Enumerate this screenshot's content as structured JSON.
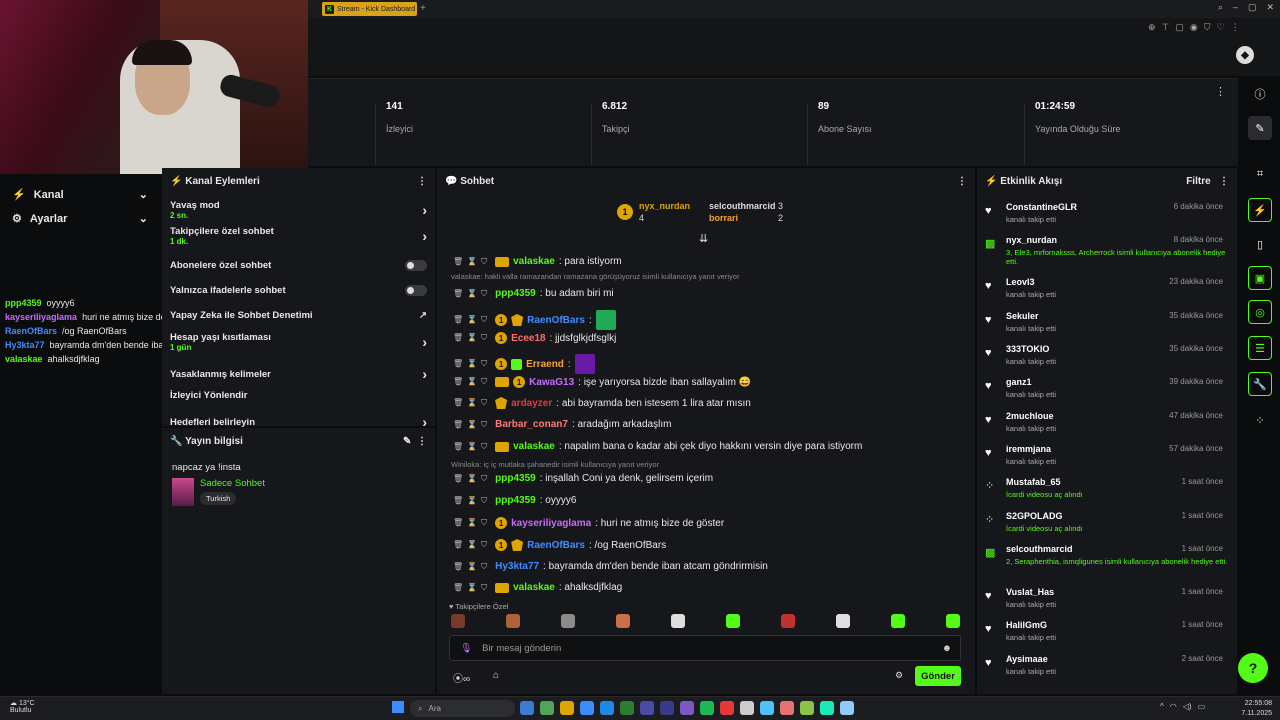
{
  "browser": {
    "tab_title": "Stream - Kick Dashboard",
    "tab_icon_letter": "K"
  },
  "sidebar": {
    "items": [
      {
        "label": "Kanal",
        "icon": "bolt-icon"
      },
      {
        "label": "Ayarlar",
        "icon": "gear-icon"
      }
    ]
  },
  "overlay_chat": [
    {
      "user": "ppp4359",
      "text": "oyyyy6",
      "color": "#53fc18"
    },
    {
      "user": "kayseriliyaglama",
      "text": "huri ne atmış bize de göster",
      "color": "#c86bff"
    },
    {
      "user": "RaenOfBars",
      "text": "/og RaenOfBars",
      "color": "#3f8cff"
    },
    {
      "user": "Hy3kta77",
      "text": "bayramda dm'den bende iban atcam göndrirmisin",
      "color": "#3f8cff"
    },
    {
      "user": "valaskae",
      "text": "ahalksdjfklag",
      "color": "#53fc18"
    }
  ],
  "stats": [
    {
      "value": "141",
      "label": "İzleyici"
    },
    {
      "value": "6.812",
      "label": "Takipçi"
    },
    {
      "value": "89",
      "label": "Abone Sayısı"
    },
    {
      "value": "01:24:59",
      "label": "Yayında Olduğu Süre"
    }
  ],
  "kanal_eylemleri": {
    "title": "Kanal Eylemleri",
    "rows": [
      {
        "label": "Yavaş mod",
        "sub": "2 sn.",
        "control": "chevron"
      },
      {
        "label": "Takipçilere özel sohbet",
        "sub": "1 dk.",
        "control": "chevron"
      },
      {
        "label": "Abonelere özel sohbet",
        "sub": "",
        "control": "toggle"
      },
      {
        "label": "Yalnızca ifadelerle sohbet",
        "sub": "",
        "control": "toggle"
      },
      {
        "label": "Yapay Zeka ile Sohbet Denetimi",
        "sub": "",
        "control": "external"
      },
      {
        "label": "Hesap yaşı kısıtlaması",
        "sub": "1 gün",
        "control": "chevron"
      },
      {
        "label": "Yasaklanmış kelimeler",
        "sub": "",
        "control": "chevron"
      },
      {
        "label": "İzleyici Yönlendir",
        "sub": "",
        "control": "none"
      },
      {
        "label": "Hedefleri belirleyin",
        "sub": "",
        "control": "chevron"
      }
    ]
  },
  "yayin_bilgisi": {
    "title": "Yayın bilgisi",
    "stream_title": "napcaz ya !insta",
    "category": "Sadece Sohbet",
    "tag": "Turkish"
  },
  "chat": {
    "title": "Sohbet",
    "pinned": [
      {
        "user": "nyx_nurdan",
        "count": "4"
      },
      {
        "user": "selcouthmarcid",
        "count": "3"
      },
      {
        "user": "borrari",
        "count": "2"
      }
    ],
    "messages": [
      {
        "user": "valaskae",
        "text": ": para istiyorm",
        "color": "#53fc18",
        "badges": [
          "crown"
        ]
      },
      {
        "reply": "valaskae: hakli valla ramazandan ramazana görüşüyoruz isimli kullanıcıya yanıt veriyor"
      },
      {
        "user": "ppp4359",
        "text": ": bu adam biri mi",
        "color": "#53fc18",
        "badges": []
      },
      {
        "user": "RaenOfBars",
        "text": ":",
        "color": "#3f8cff",
        "badges": [
          "one",
          "shield"
        ],
        "emote": "#1faa55"
      },
      {
        "user": "Ecee18",
        "text": ": jjdsfglkjdfsglkj",
        "color": "#ff6b6b",
        "badges": [
          "one"
        ]
      },
      {
        "user": "Erraend",
        "text": ":",
        "color": "#f7a23a",
        "badges": [
          "one",
          "gift"
        ],
        "emote": "#6a1aa8"
      },
      {
        "user": "KawaG13",
        "text": ": işe yarıyorsa bizde iban sallayalım 😄",
        "color": "#c86bff",
        "badges": [
          "crown",
          "one"
        ]
      },
      {
        "user": "ardayzer",
        "text": ": abi bayramda ben istesem 1 lira atar mısın",
        "color": "#e03b3b",
        "badges": [
          "shield"
        ]
      },
      {
        "user": "Barbar_conan7",
        "text": ": aradağım arkadaşlım",
        "color": "#ff7a7a",
        "badges": []
      },
      {
        "user": "valaskae",
        "text": ": napalım bana o kadar abi çek diyo hakkını versin diye para istiyorm",
        "color": "#53fc18",
        "badges": [
          "crown"
        ]
      },
      {
        "reply": "Winiloka: iç iç mutlaka şahanedir isimli kullanıcıya yanıt veriyor"
      },
      {
        "user": "ppp4359",
        "text": ": inşallah Coni ya denk, gelirsem içerim",
        "color": "#53fc18",
        "badges": []
      },
      {
        "user": "ppp4359",
        "text": ": oyyyy6",
        "color": "#53fc18",
        "badges": []
      },
      {
        "user": "kayseriliyaglama",
        "text": ": huri ne atmış bize de göster",
        "color": "#c86bff",
        "badges": [
          "one"
        ]
      },
      {
        "user": "RaenOfBars",
        "text": ": /og RaenOfBars",
        "color": "#3f8cff",
        "badges": [
          "one",
          "shield"
        ]
      },
      {
        "user": "Hy3kta77",
        "text": ": bayramda dm'den bende iban atcam göndrirmisin",
        "color": "#3f8cff",
        "badges": []
      },
      {
        "user": "valaskae",
        "text": ": ahalksdjfklag",
        "color": "#53fc18",
        "badges": [
          "crown"
        ]
      }
    ],
    "emote_label": "Takipçilere Özel",
    "input_placeholder": "Bir mesaj gönderin",
    "send_label": "Gönder"
  },
  "events": {
    "title": "Etkinlik Akışı",
    "filter_label": "Filtre",
    "items": [
      {
        "name": "ConstantineGLR",
        "desc": "kanalı takip etti",
        "time": "6 dakika önce",
        "icon": "heart"
      },
      {
        "name": "nyx_nurdan",
        "desc": "3, Efe3, mrfornaksss, Archerrock isimli kullanıcıya abonelik hediye etti.",
        "time": "8 dakika önce",
        "icon": "gift"
      },
      {
        "name": "Leovl3",
        "desc": "kanalı takip etti",
        "time": "23 dakika önce",
        "icon": "heart"
      },
      {
        "name": "Sekuler",
        "desc": "kanalı takip etti",
        "time": "35 dakika önce",
        "icon": "heart"
      },
      {
        "name": "333TOKIO",
        "desc": "kanalı takip etti",
        "time": "35 dakika önce",
        "icon": "heart"
      },
      {
        "name": "ganz1",
        "desc": "kanalı takip etti",
        "time": "39 dakika önce",
        "icon": "heart"
      },
      {
        "name": "2muchloue",
        "desc": "kanalı takip etti",
        "time": "47 dakika önce",
        "icon": "heart"
      },
      {
        "name": "iremmjana",
        "desc": "kanalı takip etti",
        "time": "57 dakika önce",
        "icon": "heart"
      },
      {
        "name": "Mustafab_65",
        "desc": "İcardi videosu aç alındı",
        "time": "1 saat önce",
        "icon": "points"
      },
      {
        "name": "S2GPOLADG",
        "desc": "İcardi videosu aç alındı",
        "time": "1 saat önce",
        "icon": "points"
      },
      {
        "name": "selcouthmarcid",
        "desc": "2, Seraphenthia, ismqligunes isimli kullanıcıya abonelik hediye etti.",
        "time": "1 saat önce",
        "icon": "gift"
      },
      {
        "name": "Vuslat_Has",
        "desc": "kanalı takip etti",
        "time": "1 saat önce",
        "icon": "heart"
      },
      {
        "name": "HalilGmG",
        "desc": "kanalı takip etti",
        "time": "1 saat önce",
        "icon": "heart"
      },
      {
        "name": "Aysimaae",
        "desc": "kanalı takip etti",
        "time": "2 saat önce",
        "icon": "heart"
      }
    ]
  },
  "taskbar": {
    "weather_temp": "13°C",
    "weather_desc": "Bulutlu",
    "search_placeholder": "Ara",
    "time": "22:55:08",
    "date": "7.11.2025"
  },
  "colors": {
    "accent": "#53fc18",
    "panel": "#16171a",
    "bg": "#0b0c0d"
  }
}
